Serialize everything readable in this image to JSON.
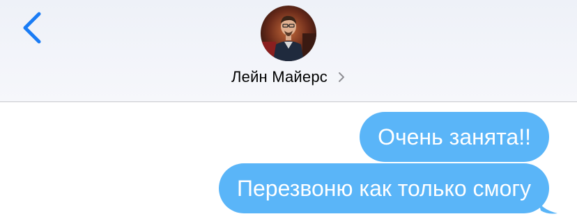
{
  "header": {
    "back_icon": "chevron-left-icon",
    "contact_name": "Лейн Майерс",
    "contact_chevron_icon": "chevron-right-icon",
    "avatar_icon": "contact-photo",
    "background": "#f3f5fa"
  },
  "messages": [
    {
      "text": "Очень занята!!",
      "direction": "outgoing"
    },
    {
      "text": "Перезвоню как только смогу",
      "direction": "outgoing"
    }
  ],
  "colors": {
    "accent": "#1a7cf5",
    "outgoing_bubble": "#5ab5f8",
    "bubble_text": "#ffffff",
    "divider": "#c9c9ce"
  }
}
